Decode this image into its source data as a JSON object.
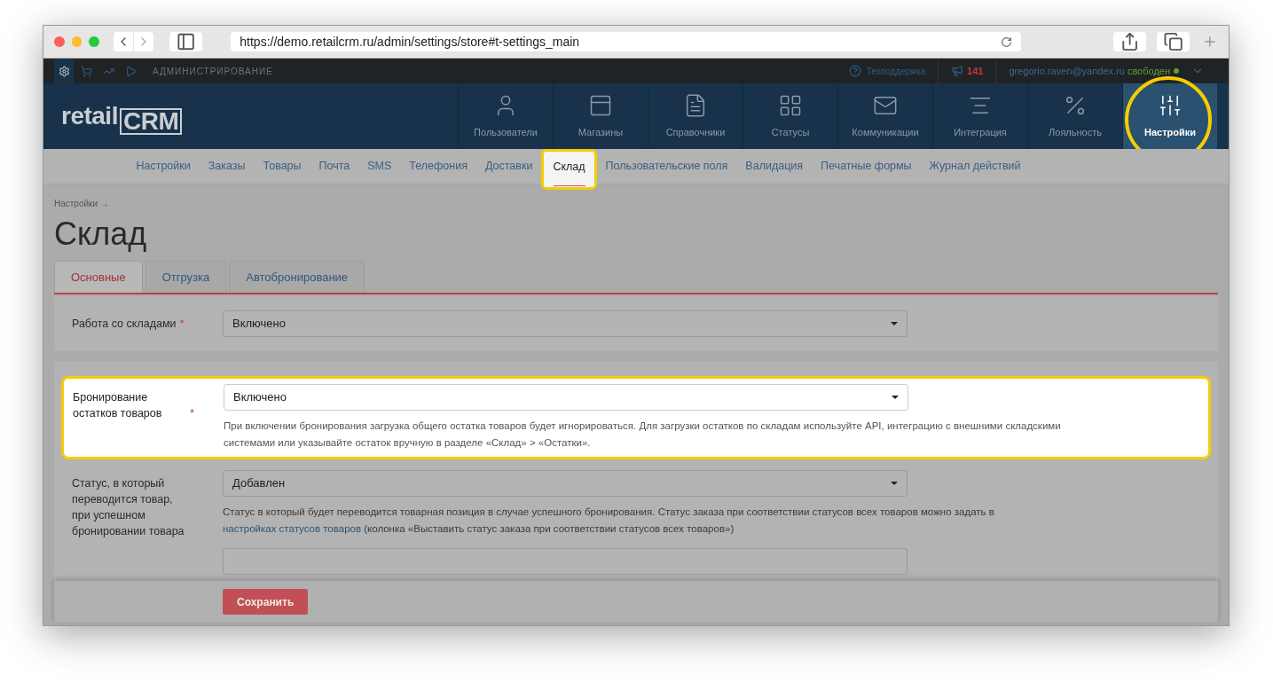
{
  "browser": {
    "url": "https://demo.retailcrm.ru/admin/settings/store#t-settings_main"
  },
  "topbar": {
    "section": "АДМИНИСТРИРОВАНИЕ",
    "support": "Техподдержка",
    "notifications": "141",
    "user": "gregorio.raven@yandex.ru",
    "status": "свободен"
  },
  "logo": {
    "first": "retail",
    "second": "CRM"
  },
  "main_nav": [
    {
      "label": "Пользователи",
      "kind": "user",
      "selected": false,
      "highlighted": false
    },
    {
      "label": "Магазины",
      "kind": "store",
      "selected": false,
      "highlighted": false
    },
    {
      "label": "Справочники",
      "kind": "book",
      "selected": false,
      "highlighted": false
    },
    {
      "label": "Статусы",
      "kind": "statuses",
      "selected": false,
      "highlighted": false
    },
    {
      "label": "Коммуникации",
      "kind": "mail",
      "selected": false,
      "highlighted": false
    },
    {
      "label": "Интеграция",
      "kind": "integration",
      "selected": false,
      "highlighted": false
    },
    {
      "label": "Лояльность",
      "kind": "loyalty",
      "selected": false,
      "highlighted": false
    },
    {
      "label": "Настройки",
      "kind": "settings",
      "selected": true,
      "highlighted": true
    }
  ],
  "sub_nav": [
    {
      "label": "Настройки",
      "selected": false,
      "highlighted": false
    },
    {
      "label": "Заказы",
      "selected": false,
      "highlighted": false
    },
    {
      "label": "Товары",
      "selected": false,
      "highlighted": false
    },
    {
      "label": "Почта",
      "selected": false,
      "highlighted": false
    },
    {
      "label": "SMS",
      "selected": false,
      "highlighted": false
    },
    {
      "label": "Телефония",
      "selected": false,
      "highlighted": false
    },
    {
      "label": "Доставки",
      "selected": false,
      "highlighted": false
    },
    {
      "label": "Склад",
      "selected": true,
      "highlighted": true
    },
    {
      "label": "Пользовательские поля",
      "selected": false,
      "highlighted": false
    },
    {
      "label": "Валидация",
      "selected": false,
      "highlighted": false
    },
    {
      "label": "Печатные формы",
      "selected": false,
      "highlighted": false
    },
    {
      "label": "Журнал действий",
      "selected": false,
      "highlighted": false
    }
  ],
  "breadcrumb": "Настройки →",
  "title": "Склад",
  "tabs": [
    {
      "label": "Основные",
      "selected": true
    },
    {
      "label": "Отгрузка",
      "selected": false
    },
    {
      "label": "Автобронирование",
      "selected": false
    }
  ],
  "fields": [
    {
      "label": "Работа со складами",
      "required_mark": "*",
      "value": "Включено",
      "highlighted": false
    },
    {
      "label": "Бронирование остатков товаров",
      "required_mark": "*",
      "value": "Включено",
      "highlighted": true,
      "hint": "При включении бронирования загрузка общего остатка товаров будет игнорироваться. Для загрузки остатков по складам используйте API, интеграцию с внешними складскими системами или указывайте остаток вручную в разделе «Склад» > «Остатки»."
    },
    {
      "label": "Статус, в который переводится товар, при успешном бронировании товара",
      "value": "Добавлен",
      "highlighted": false,
      "hint": "Статус в который будет переводится товарная позиция в случае успешного бронирования. Статус заказа при соответствии статусов всех товаров можно задать в ",
      "hint_link": "настройках статусов товаров",
      "hint_after": " (колонка «Выставить статус заказа при соответствии статусов всех товаров»)"
    }
  ],
  "save_button": "Сохранить"
}
